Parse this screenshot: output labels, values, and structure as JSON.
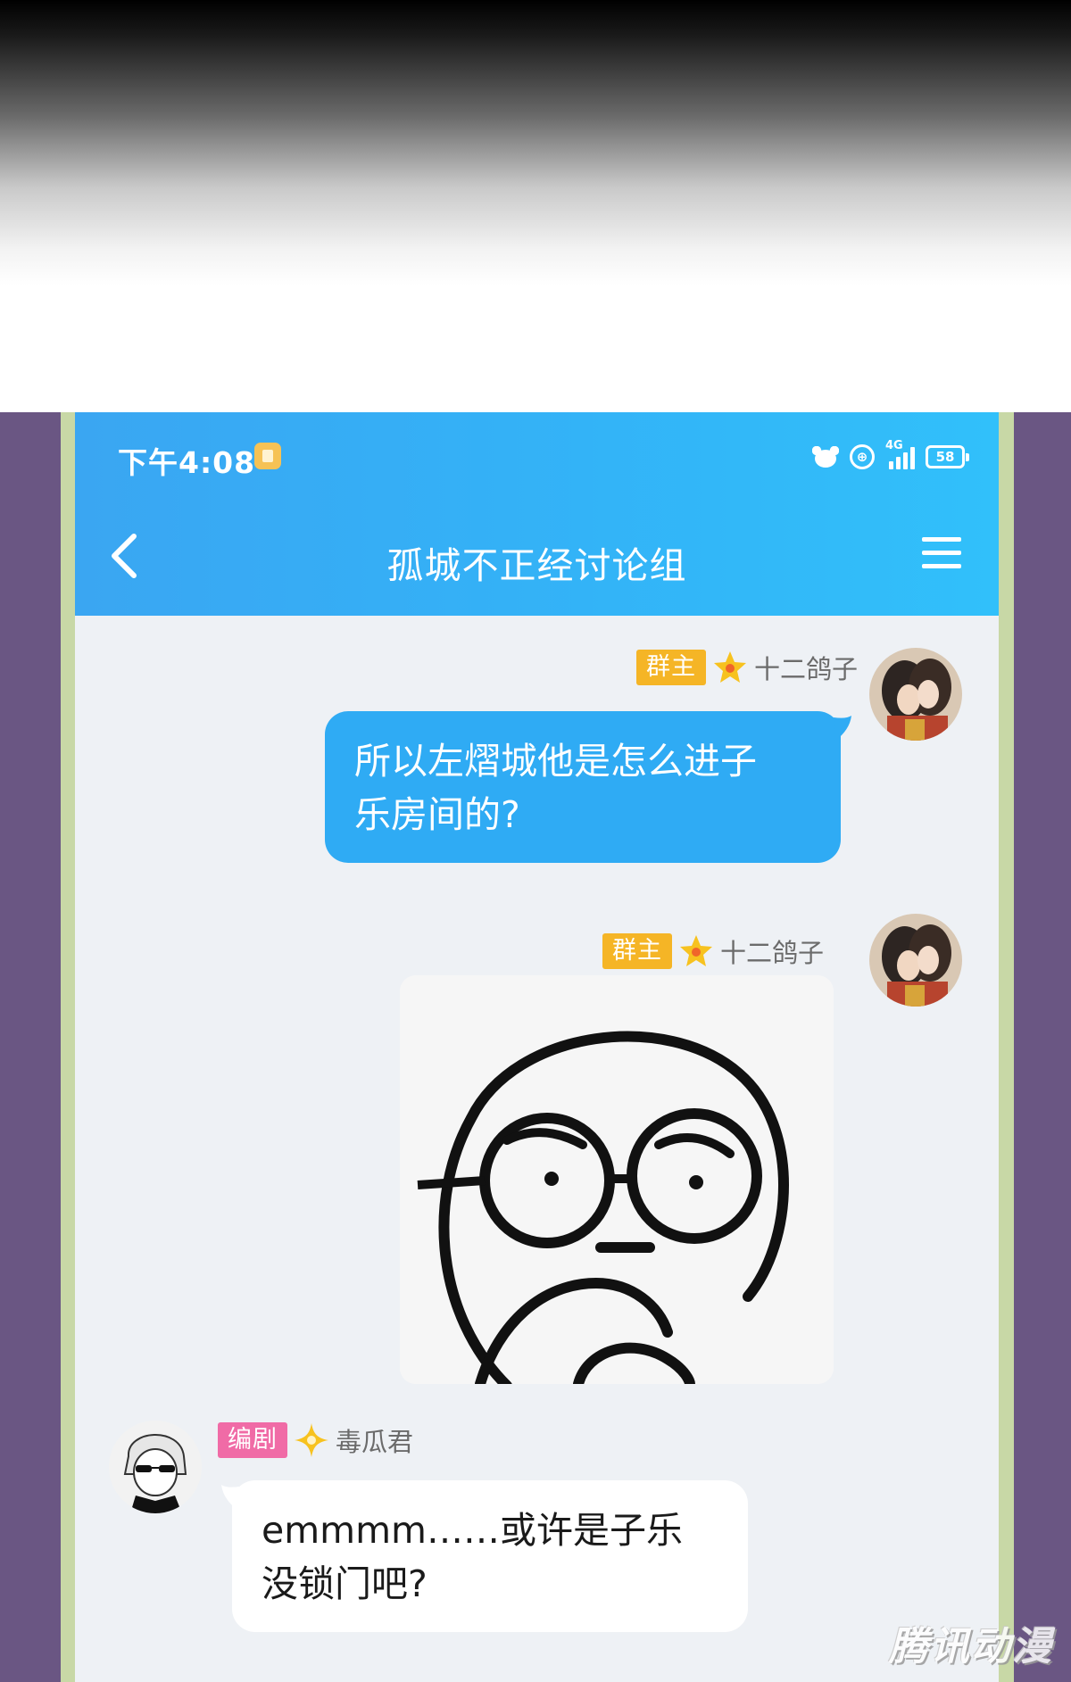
{
  "status_bar": {
    "time": "下午4:08",
    "network": "4G",
    "battery": "58",
    "data_symbol": "⊕"
  },
  "nav": {
    "title": "孤城不正经讨论组"
  },
  "messages": [
    {
      "sender": "十二鸽子",
      "role": "群主",
      "text": "所以左熠城他是怎么进子乐房间的?",
      "line1": "所以左熠城他是怎么进子",
      "line2": "乐房间的?"
    },
    {
      "sender": "十二鸽子",
      "role": "群主",
      "type": "sticker"
    },
    {
      "sender": "毒瓜君",
      "role": "编剧",
      "text": "emmmm……或许是子乐没锁门吧?",
      "line1": "emmmm……或许是子乐",
      "line2": "没锁门吧?"
    }
  ],
  "watermark": "腾讯动漫",
  "colors": {
    "header_start": "#3aa6f2",
    "header_end": "#31c0fa",
    "bubble_blue": "#2fabf4",
    "owner_badge": "#f5b526",
    "writer_badge": "#f06ba6",
    "side_purple": "#6a5683",
    "frame_green": "#c8d8a6"
  }
}
